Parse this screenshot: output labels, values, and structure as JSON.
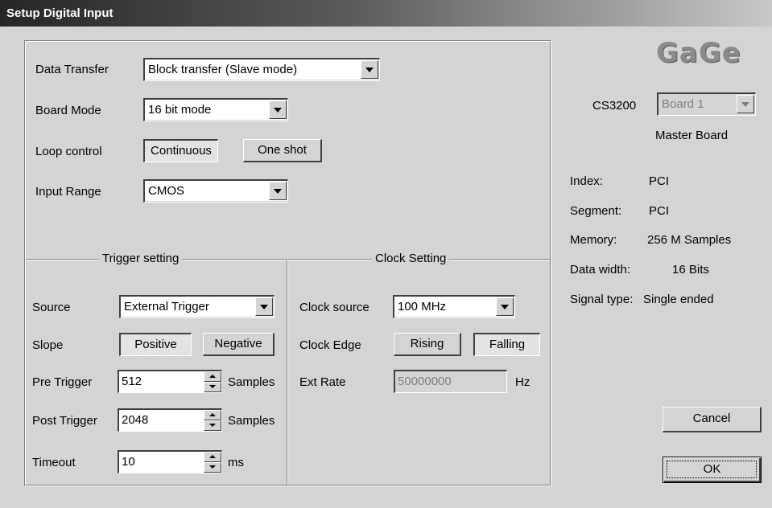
{
  "window": {
    "title": "Setup Digital Input"
  },
  "brand": {
    "logo_text": "GaGe"
  },
  "general": {
    "data_transfer_label": "Data Transfer",
    "data_transfer_value": "Block transfer (Slave mode)",
    "board_mode_label": "Board Mode",
    "board_mode_value": "16 bit mode",
    "loop_control_label": "Loop control",
    "loop_continuous": "Continuous",
    "loop_one_shot": "One shot",
    "input_range_label": "Input Range",
    "input_range_value": "CMOS"
  },
  "trigger": {
    "group_title": "Trigger setting",
    "source_label": "Source",
    "source_value": "External Trigger",
    "slope_label": "Slope",
    "slope_positive": "Positive",
    "slope_negative": "Negative",
    "pre_label": "Pre Trigger",
    "pre_value": "512",
    "pre_unit": "Samples",
    "post_label": "Post Trigger",
    "post_value": "2048",
    "post_unit": "Samples",
    "timeout_label": "Timeout",
    "timeout_value": "10",
    "timeout_unit": "ms"
  },
  "clock": {
    "group_title": "Clock Setting",
    "source_label": "Clock source",
    "source_value": "100 MHz",
    "edge_label": "Clock Edge",
    "edge_rising": "Rising",
    "edge_falling": "Falling",
    "ext_rate_label": "Ext Rate",
    "ext_rate_value": "50000000",
    "ext_rate_unit": "Hz"
  },
  "board": {
    "model": "CS3200",
    "board_select_value": "Board 1",
    "role": "Master Board",
    "info": [
      {
        "label": "Index:",
        "value": "PCI"
      },
      {
        "label": "Segment:",
        "value": "PCI"
      },
      {
        "label": "Memory:",
        "value": "256 M  Samples"
      },
      {
        "label": "Data width:",
        "value": "16 Bits"
      },
      {
        "label": "Signal type:",
        "value": "Single ended"
      }
    ]
  },
  "actions": {
    "cancel_label": "Cancel",
    "ok_label": "OK"
  },
  "colors": {
    "dialog_bg": "#d4d4d4",
    "title_bar_dark": "#262626",
    "logo": "#8a8a8a"
  }
}
